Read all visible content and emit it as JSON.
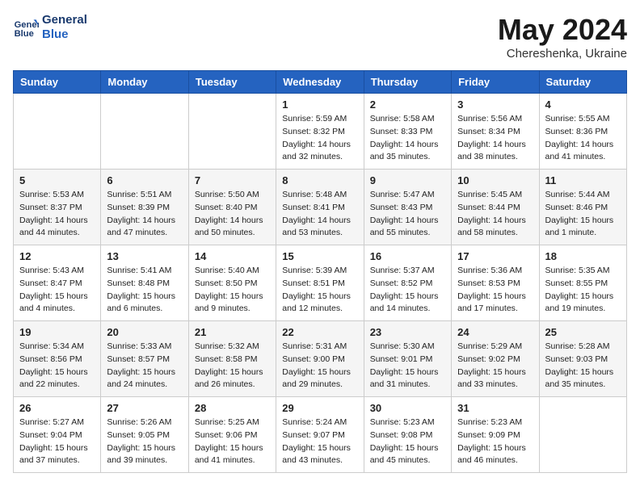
{
  "header": {
    "logo_line1": "General",
    "logo_line2": "Blue",
    "month_title": "May 2024",
    "subtitle": "Chereshenka, Ukraine"
  },
  "weekdays": [
    "Sunday",
    "Monday",
    "Tuesday",
    "Wednesday",
    "Thursday",
    "Friday",
    "Saturday"
  ],
  "weeks": [
    [
      {
        "day": "",
        "sunrise": "",
        "sunset": "",
        "daylight": ""
      },
      {
        "day": "",
        "sunrise": "",
        "sunset": "",
        "daylight": ""
      },
      {
        "day": "",
        "sunrise": "",
        "sunset": "",
        "daylight": ""
      },
      {
        "day": "1",
        "sunrise": "Sunrise: 5:59 AM",
        "sunset": "Sunset: 8:32 PM",
        "daylight": "Daylight: 14 hours and 32 minutes."
      },
      {
        "day": "2",
        "sunrise": "Sunrise: 5:58 AM",
        "sunset": "Sunset: 8:33 PM",
        "daylight": "Daylight: 14 hours and 35 minutes."
      },
      {
        "day": "3",
        "sunrise": "Sunrise: 5:56 AM",
        "sunset": "Sunset: 8:34 PM",
        "daylight": "Daylight: 14 hours and 38 minutes."
      },
      {
        "day": "4",
        "sunrise": "Sunrise: 5:55 AM",
        "sunset": "Sunset: 8:36 PM",
        "daylight": "Daylight: 14 hours and 41 minutes."
      }
    ],
    [
      {
        "day": "5",
        "sunrise": "Sunrise: 5:53 AM",
        "sunset": "Sunset: 8:37 PM",
        "daylight": "Daylight: 14 hours and 44 minutes."
      },
      {
        "day": "6",
        "sunrise": "Sunrise: 5:51 AM",
        "sunset": "Sunset: 8:39 PM",
        "daylight": "Daylight: 14 hours and 47 minutes."
      },
      {
        "day": "7",
        "sunrise": "Sunrise: 5:50 AM",
        "sunset": "Sunset: 8:40 PM",
        "daylight": "Daylight: 14 hours and 50 minutes."
      },
      {
        "day": "8",
        "sunrise": "Sunrise: 5:48 AM",
        "sunset": "Sunset: 8:41 PM",
        "daylight": "Daylight: 14 hours and 53 minutes."
      },
      {
        "day": "9",
        "sunrise": "Sunrise: 5:47 AM",
        "sunset": "Sunset: 8:43 PM",
        "daylight": "Daylight: 14 hours and 55 minutes."
      },
      {
        "day": "10",
        "sunrise": "Sunrise: 5:45 AM",
        "sunset": "Sunset: 8:44 PM",
        "daylight": "Daylight: 14 hours and 58 minutes."
      },
      {
        "day": "11",
        "sunrise": "Sunrise: 5:44 AM",
        "sunset": "Sunset: 8:46 PM",
        "daylight": "Daylight: 15 hours and 1 minute."
      }
    ],
    [
      {
        "day": "12",
        "sunrise": "Sunrise: 5:43 AM",
        "sunset": "Sunset: 8:47 PM",
        "daylight": "Daylight: 15 hours and 4 minutes."
      },
      {
        "day": "13",
        "sunrise": "Sunrise: 5:41 AM",
        "sunset": "Sunset: 8:48 PM",
        "daylight": "Daylight: 15 hours and 6 minutes."
      },
      {
        "day": "14",
        "sunrise": "Sunrise: 5:40 AM",
        "sunset": "Sunset: 8:50 PM",
        "daylight": "Daylight: 15 hours and 9 minutes."
      },
      {
        "day": "15",
        "sunrise": "Sunrise: 5:39 AM",
        "sunset": "Sunset: 8:51 PM",
        "daylight": "Daylight: 15 hours and 12 minutes."
      },
      {
        "day": "16",
        "sunrise": "Sunrise: 5:37 AM",
        "sunset": "Sunset: 8:52 PM",
        "daylight": "Daylight: 15 hours and 14 minutes."
      },
      {
        "day": "17",
        "sunrise": "Sunrise: 5:36 AM",
        "sunset": "Sunset: 8:53 PM",
        "daylight": "Daylight: 15 hours and 17 minutes."
      },
      {
        "day": "18",
        "sunrise": "Sunrise: 5:35 AM",
        "sunset": "Sunset: 8:55 PM",
        "daylight": "Daylight: 15 hours and 19 minutes."
      }
    ],
    [
      {
        "day": "19",
        "sunrise": "Sunrise: 5:34 AM",
        "sunset": "Sunset: 8:56 PM",
        "daylight": "Daylight: 15 hours and 22 minutes."
      },
      {
        "day": "20",
        "sunrise": "Sunrise: 5:33 AM",
        "sunset": "Sunset: 8:57 PM",
        "daylight": "Daylight: 15 hours and 24 minutes."
      },
      {
        "day": "21",
        "sunrise": "Sunrise: 5:32 AM",
        "sunset": "Sunset: 8:58 PM",
        "daylight": "Daylight: 15 hours and 26 minutes."
      },
      {
        "day": "22",
        "sunrise": "Sunrise: 5:31 AM",
        "sunset": "Sunset: 9:00 PM",
        "daylight": "Daylight: 15 hours and 29 minutes."
      },
      {
        "day": "23",
        "sunrise": "Sunrise: 5:30 AM",
        "sunset": "Sunset: 9:01 PM",
        "daylight": "Daylight: 15 hours and 31 minutes."
      },
      {
        "day": "24",
        "sunrise": "Sunrise: 5:29 AM",
        "sunset": "Sunset: 9:02 PM",
        "daylight": "Daylight: 15 hours and 33 minutes."
      },
      {
        "day": "25",
        "sunrise": "Sunrise: 5:28 AM",
        "sunset": "Sunset: 9:03 PM",
        "daylight": "Daylight: 15 hours and 35 minutes."
      }
    ],
    [
      {
        "day": "26",
        "sunrise": "Sunrise: 5:27 AM",
        "sunset": "Sunset: 9:04 PM",
        "daylight": "Daylight: 15 hours and 37 minutes."
      },
      {
        "day": "27",
        "sunrise": "Sunrise: 5:26 AM",
        "sunset": "Sunset: 9:05 PM",
        "daylight": "Daylight: 15 hours and 39 minutes."
      },
      {
        "day": "28",
        "sunrise": "Sunrise: 5:25 AM",
        "sunset": "Sunset: 9:06 PM",
        "daylight": "Daylight: 15 hours and 41 minutes."
      },
      {
        "day": "29",
        "sunrise": "Sunrise: 5:24 AM",
        "sunset": "Sunset: 9:07 PM",
        "daylight": "Daylight: 15 hours and 43 minutes."
      },
      {
        "day": "30",
        "sunrise": "Sunrise: 5:23 AM",
        "sunset": "Sunset: 9:08 PM",
        "daylight": "Daylight: 15 hours and 45 minutes."
      },
      {
        "day": "31",
        "sunrise": "Sunrise: 5:23 AM",
        "sunset": "Sunset: 9:09 PM",
        "daylight": "Daylight: 15 hours and 46 minutes."
      },
      {
        "day": "",
        "sunrise": "",
        "sunset": "",
        "daylight": ""
      }
    ]
  ]
}
